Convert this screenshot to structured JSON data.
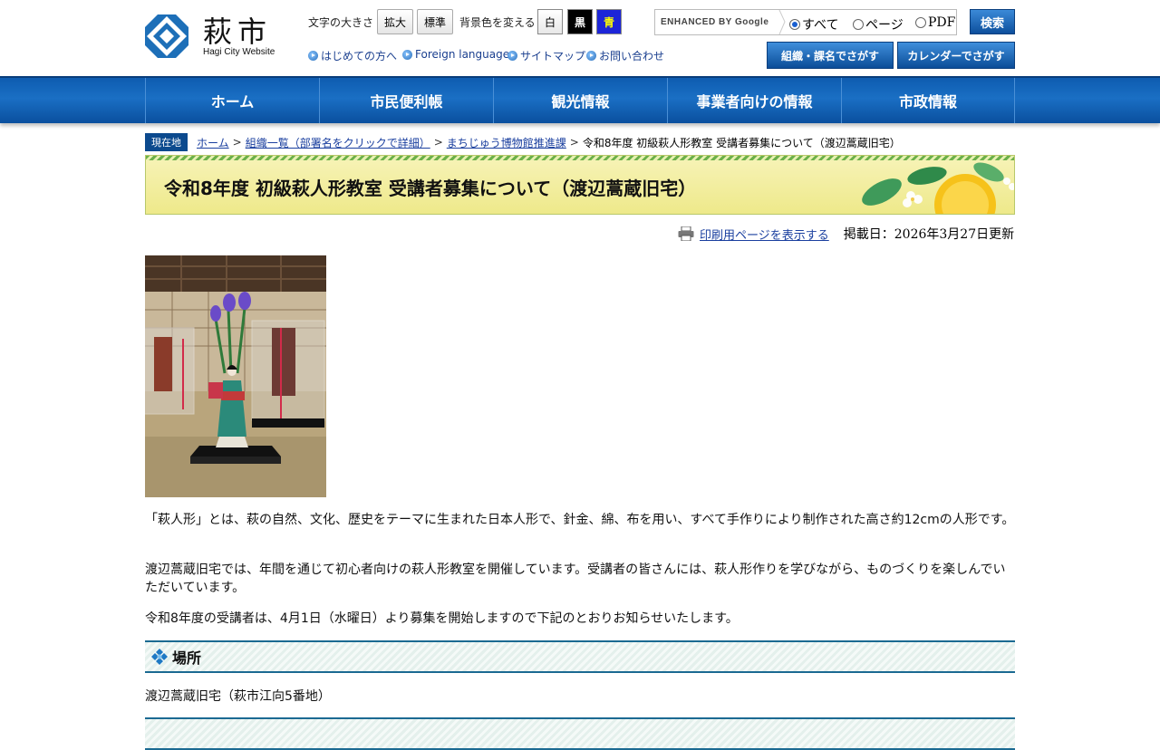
{
  "site": {
    "logo_kanji": "萩市",
    "logo_sub": "Hagi City Website"
  },
  "tools": {
    "text_size_label": "文字の大きさ",
    "enlarge": "拡大",
    "standard": "標準",
    "bg_color_label": "背景色を変える",
    "white": "白",
    "black": "黒",
    "blue": "青"
  },
  "quick_links": [
    "はじめての方へ",
    "Foreign language",
    "サイトマップ",
    "お問い合わせ"
  ],
  "search": {
    "placeholder": "ENHANCED BY Google",
    "scopes": [
      "すべて",
      "ページ",
      "PDF"
    ],
    "selected_scope": "すべて",
    "button": "検索",
    "org_button": "組織・課名でさがす",
    "calendar_button": "カレンダーでさがす"
  },
  "nav": [
    "ホーム",
    "市民便利帳",
    "観光情報",
    "事業者向けの情報",
    "市政情報"
  ],
  "breadcrumb": {
    "tag": "現在地",
    "items": [
      "ホーム",
      "組織一覧（部署名をクリックで詳細）",
      "まちじゅう博物館推進課"
    ],
    "current": "令和8年度 初級萩人形教室 受講者募集について（渡辺蒿蔵旧宅）"
  },
  "page": {
    "title": "令和8年度 初級萩人形教室 受講者募集について（渡辺蒿蔵旧宅）",
    "print_link": "印刷用ページを表示する",
    "published": "掲載日：2026年3月27日更新",
    "paragraphs": [
      "「萩人形」とは、萩の自然、文化、歴史をテーマに生まれた日本人形で、針金、綿、布を用い、すべて手作りにより制作された高さ約12cmの人形です。",
      "渡辺蒿蔵旧宅では、年間を通じて初心者向けの萩人形教室を開催しています。受講者の皆さんには、萩人形作りを学びながら、ものづくりを楽しんでいただいています。",
      "令和8年度の受講者は、4月1日（水曜日）より募集を開始しますので下記のとおりお知らせいたします。"
    ],
    "section_location": {
      "heading": "場所",
      "text": "渡辺蒿蔵旧宅（萩市江向5番地）"
    }
  },
  "colors": {
    "nav_blue": "#1a6fc4",
    "link": "#1a3f9f",
    "heading_border": "#1b6a92"
  }
}
